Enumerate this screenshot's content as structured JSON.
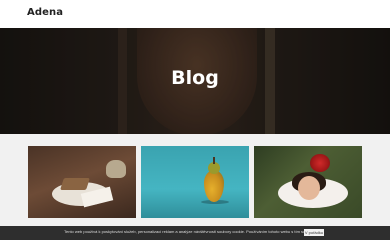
{
  "header": {
    "logo": "Adena"
  },
  "hero": {
    "title": "Blog"
  },
  "posts": [
    {
      "image": "tea-and-cake-photo"
    },
    {
      "image": "pear-photo"
    },
    {
      "image": "girl-with-roses-photo"
    }
  ],
  "cookie_bar": {
    "text": "Tento web používá k poskytování služeb, personalizaci reklam a analýze návštěvnosti soubory cookie. Používáním tohoto webu s tím souhlasíte.",
    "button_label": "V pořádku"
  }
}
